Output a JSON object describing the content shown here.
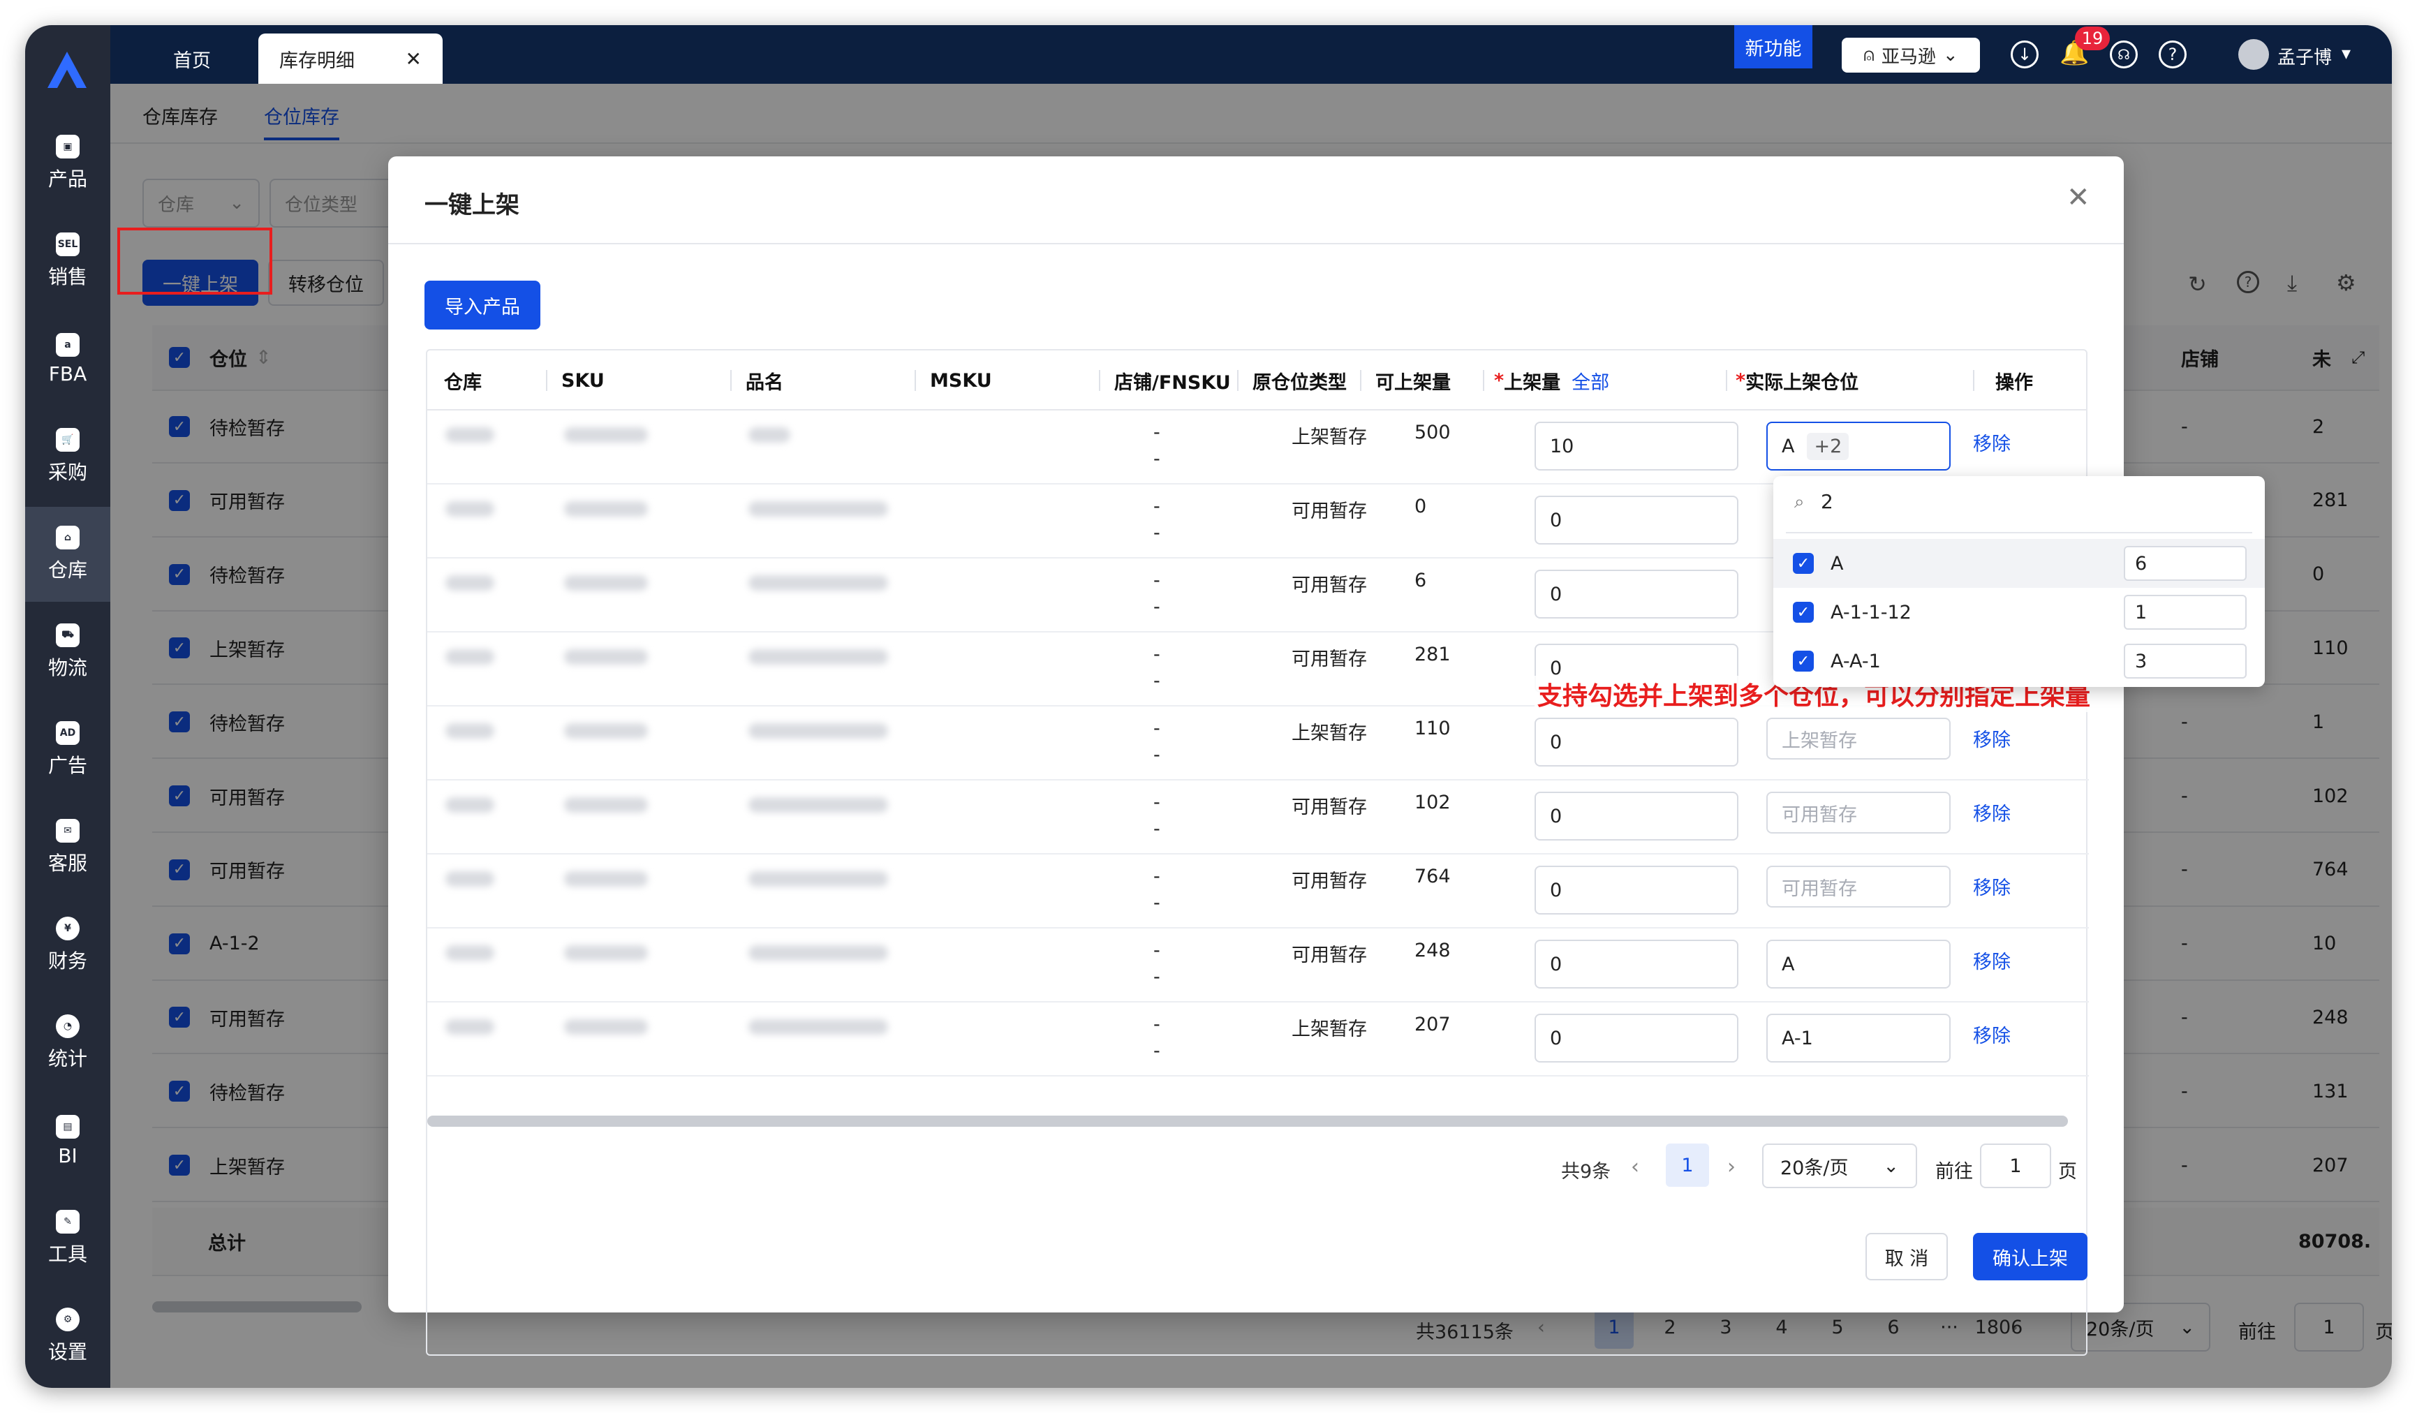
{
  "tabs": {
    "home": "首页",
    "active": "库存明细"
  },
  "header": {
    "new_feature": "新功能",
    "marketplace": "亚马逊",
    "notification_count": "19",
    "user": "孟子博"
  },
  "sidebar": [
    "产品",
    "销售",
    "FBA",
    "采购",
    "仓库",
    "物流",
    "广告",
    "客服",
    "财务",
    "统计",
    "BI",
    "工具",
    "设置"
  ],
  "sidebar_icons": {
    "销售": "SEL",
    "FBA": "a",
    "广告": "AD"
  },
  "subtabs": [
    "仓库库存",
    "仓位库存"
  ],
  "filters": {
    "warehouse": "仓库",
    "location_type": "仓位类型"
  },
  "toolbar": {
    "shelve": "一键上架",
    "transfer": "转移仓位"
  },
  "bg_table": {
    "col_location": "仓位",
    "col_store": "店铺",
    "col_last": "未",
    "rows": [
      {
        "loc": "待检暂存",
        "store": "-",
        "val": "2"
      },
      {
        "loc": "可用暂存",
        "store": "-",
        "val": "281"
      },
      {
        "loc": "待检暂存",
        "store": "-",
        "val": "0"
      },
      {
        "loc": "上架暂存",
        "store": "-",
        "val": "110"
      },
      {
        "loc": "待检暂存",
        "store": "-",
        "val": "1"
      },
      {
        "loc": "可用暂存",
        "store": "-",
        "val": "102"
      },
      {
        "loc": "可用暂存",
        "store": "-",
        "val": "764"
      },
      {
        "loc": "A-1-2",
        "store": "-",
        "val": "10"
      },
      {
        "loc": "可用暂存",
        "store": "-",
        "val": "248"
      },
      {
        "loc": "待检暂存",
        "store": "-",
        "val": "131"
      },
      {
        "loc": "上架暂存",
        "store": "-",
        "val": "207"
      }
    ],
    "total_label": "总计",
    "total_value": "80708.",
    "pagination": {
      "total": "共36115条",
      "pages": [
        "1",
        "2",
        "3",
        "4",
        "5",
        "6",
        "···",
        "1806"
      ],
      "size": "20条/页",
      "goto": "前往",
      "goto_value": "1",
      "page": "页"
    }
  },
  "modal": {
    "title": "一键上架",
    "import": "导入产品",
    "columns": {
      "warehouse": "仓库",
      "sku": "SKU",
      "name": "品名",
      "msku": "MSKU",
      "fnsku": "店铺/FNSKU",
      "orig_type": "原仓位类型",
      "available": "可上架量",
      "qty": "上架量",
      "all": "全部",
      "target": "实际上架仓位",
      "ops": "操作"
    },
    "required_mark": "*",
    "rows": [
      {
        "fnsku": "-",
        "fnsku2": "-",
        "orig": "上架暂存",
        "available": "500",
        "qty": "10",
        "target": "A",
        "target_extra": "+2",
        "op": "移除"
      },
      {
        "fnsku": "-",
        "fnsku2": "-",
        "orig": "可用暂存",
        "available": "0",
        "qty": "0",
        "target": "",
        "target_extra": "",
        "op": "移除"
      },
      {
        "fnsku": "-",
        "fnsku2": "-",
        "orig": "可用暂存",
        "available": "6",
        "qty": "0",
        "target": "",
        "target_extra": "",
        "op": "移除"
      },
      {
        "fnsku": "-",
        "fnsku2": "-",
        "orig": "可用暂存",
        "available": "281",
        "qty": "0",
        "target": "",
        "target_extra": "",
        "op": "移除"
      },
      {
        "fnsku": "-",
        "fnsku2": "-",
        "orig": "上架暂存",
        "available": "110",
        "qty": "0",
        "target_ph": "上架暂存",
        "op": "移除"
      },
      {
        "fnsku": "-",
        "fnsku2": "-",
        "orig": "可用暂存",
        "available": "102",
        "qty": "0",
        "target_ph": "可用暂存",
        "op": "移除"
      },
      {
        "fnsku": "-",
        "fnsku2": "-",
        "orig": "可用暂存",
        "available": "764",
        "qty": "0",
        "target_ph": "可用暂存",
        "op": "移除"
      },
      {
        "fnsku": "-",
        "fnsku2": "-",
        "orig": "可用暂存",
        "available": "248",
        "qty": "0",
        "target": "A",
        "op": "移除"
      },
      {
        "fnsku": "-",
        "fnsku2": "-",
        "orig": "上架暂存",
        "available": "207",
        "qty": "0",
        "target": "A-1",
        "op": "移除"
      }
    ],
    "dropdown": {
      "search": "2",
      "items": [
        {
          "label": "A",
          "qty": "6"
        },
        {
          "label": "A-1-1-12",
          "qty": "1"
        },
        {
          "label": "A-A-1",
          "qty": "3"
        }
      ]
    },
    "annotation": "支持勾选并上架到多个仓位，可以分别指定上架量",
    "pagination": {
      "total": "共9条",
      "page": "1",
      "size": "20条/页",
      "goto": "前往",
      "goto_value": "1",
      "page_unit": "页"
    },
    "cancel": "取 消",
    "confirm": "确认上架"
  }
}
